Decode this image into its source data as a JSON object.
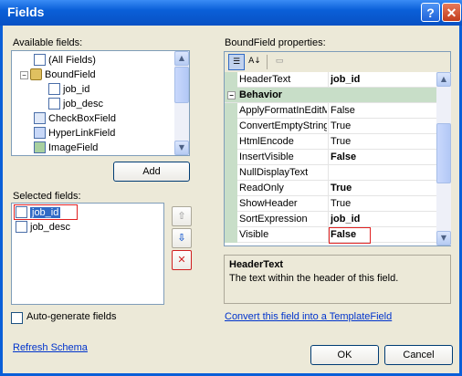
{
  "window": {
    "title": "Fields"
  },
  "available_fields": {
    "label": "Available fields:",
    "items": [
      "(All Fields)",
      "BoundField",
      "job_id",
      "job_desc",
      "CheckBoxField",
      "HyperLinkField",
      "ImageField"
    ]
  },
  "add_button": "Add",
  "selected_fields": {
    "label": "Selected fields:",
    "items": [
      "job_id",
      "job_desc"
    ]
  },
  "auto_generate": {
    "label": "Auto-generate fields",
    "checked": false
  },
  "refresh_link": "Refresh Schema",
  "properties": {
    "label": "BoundField properties:",
    "rows": [
      {
        "name": "HeaderText",
        "value": "job_id",
        "bold": true
      },
      {
        "category": "Behavior"
      },
      {
        "name": "ApplyFormatInEditM",
        "value": "False",
        "bold": false
      },
      {
        "name": "ConvertEmptyString",
        "value": "True",
        "bold": false
      },
      {
        "name": "HtmlEncode",
        "value": "True",
        "bold": false
      },
      {
        "name": "InsertVisible",
        "value": "False",
        "bold": true
      },
      {
        "name": "NullDisplayText",
        "value": "",
        "bold": false
      },
      {
        "name": "ReadOnly",
        "value": "True",
        "bold": true
      },
      {
        "name": "ShowHeader",
        "value": "True",
        "bold": false
      },
      {
        "name": "SortExpression",
        "value": "job_id",
        "bold": true
      },
      {
        "name": "Visible",
        "value": "False",
        "bold": true
      }
    ],
    "description_title": "HeaderText",
    "description_text": "The text within the header of this field."
  },
  "convert_link": "Convert this field into a TemplateField",
  "ok_button": "OK",
  "cancel_button": "Cancel"
}
